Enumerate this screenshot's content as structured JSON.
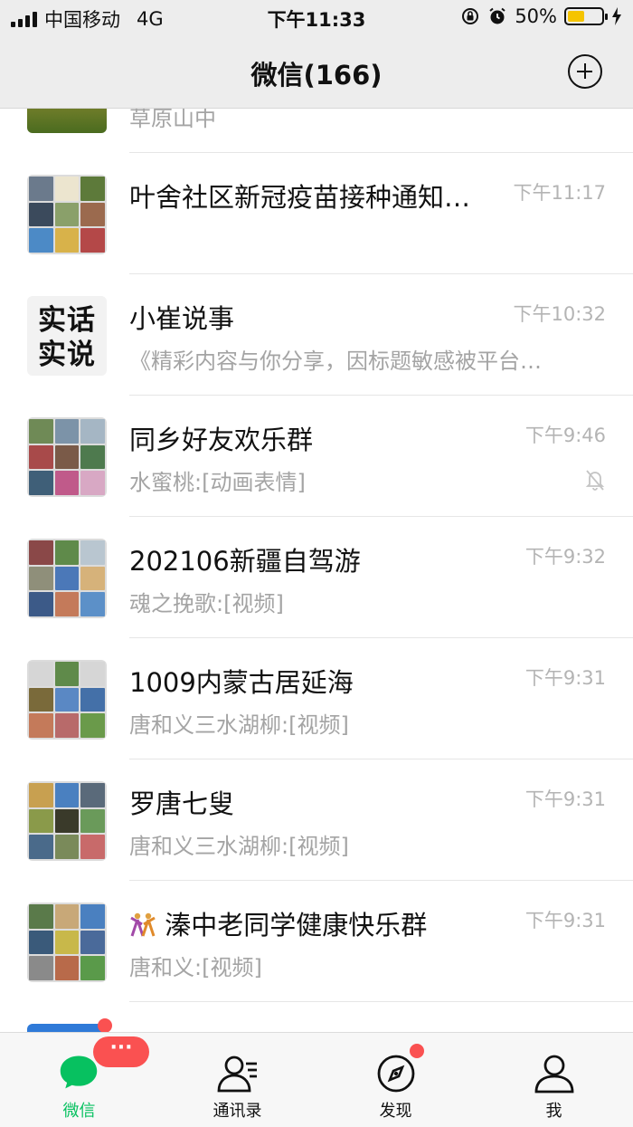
{
  "status_bar": {
    "carrier": "中国移动",
    "network": "4G",
    "time": "下午11:33",
    "battery": "50%",
    "battery_level": 0.5
  },
  "nav": {
    "title": "微信(166)",
    "add_icon": "plus-circle-icon"
  },
  "chats": [
    {
      "name": "",
      "preview": "草原山中",
      "time": ""
    },
    {
      "name": "叶舍社区新冠疫苗接种通知…",
      "preview": "",
      "time": "下午11:17"
    },
    {
      "name": "小崔说事",
      "preview": "《精彩内容与你分享，因标题敏感被平台…",
      "time": "下午10:32",
      "avatar_text": "实话实说"
    },
    {
      "name": "同乡好友欢乐群",
      "preview": "水蜜桃:[动画表情]",
      "time": "下午9:46",
      "muted": true
    },
    {
      "name": "202106新疆自驾游",
      "preview": "魂之挽歌:[视频]",
      "time": "下午9:32"
    },
    {
      "name": "1009内蒙古居延海",
      "preview": "唐和义三水湖柳:[视频]",
      "time": "下午9:31"
    },
    {
      "name": "罗唐七叟",
      "preview": "唐和义三水湖柳:[视频]",
      "time": "下午9:31"
    },
    {
      "name": "溱中老同学健康快乐群",
      "preview": "唐和义:[视频]",
      "time": "下午9:31"
    }
  ],
  "tabs": [
    {
      "label": "微信",
      "icon": "chat-bubble-icon",
      "active": true,
      "badge": "···"
    },
    {
      "label": "通讯录",
      "icon": "contacts-icon"
    },
    {
      "label": "发现",
      "icon": "compass-icon",
      "dot": true
    },
    {
      "label": "我",
      "icon": "person-icon"
    }
  ],
  "colors": {
    "accent": "#07c160",
    "badge": "#fa5151",
    "battery": "#f5c400"
  }
}
